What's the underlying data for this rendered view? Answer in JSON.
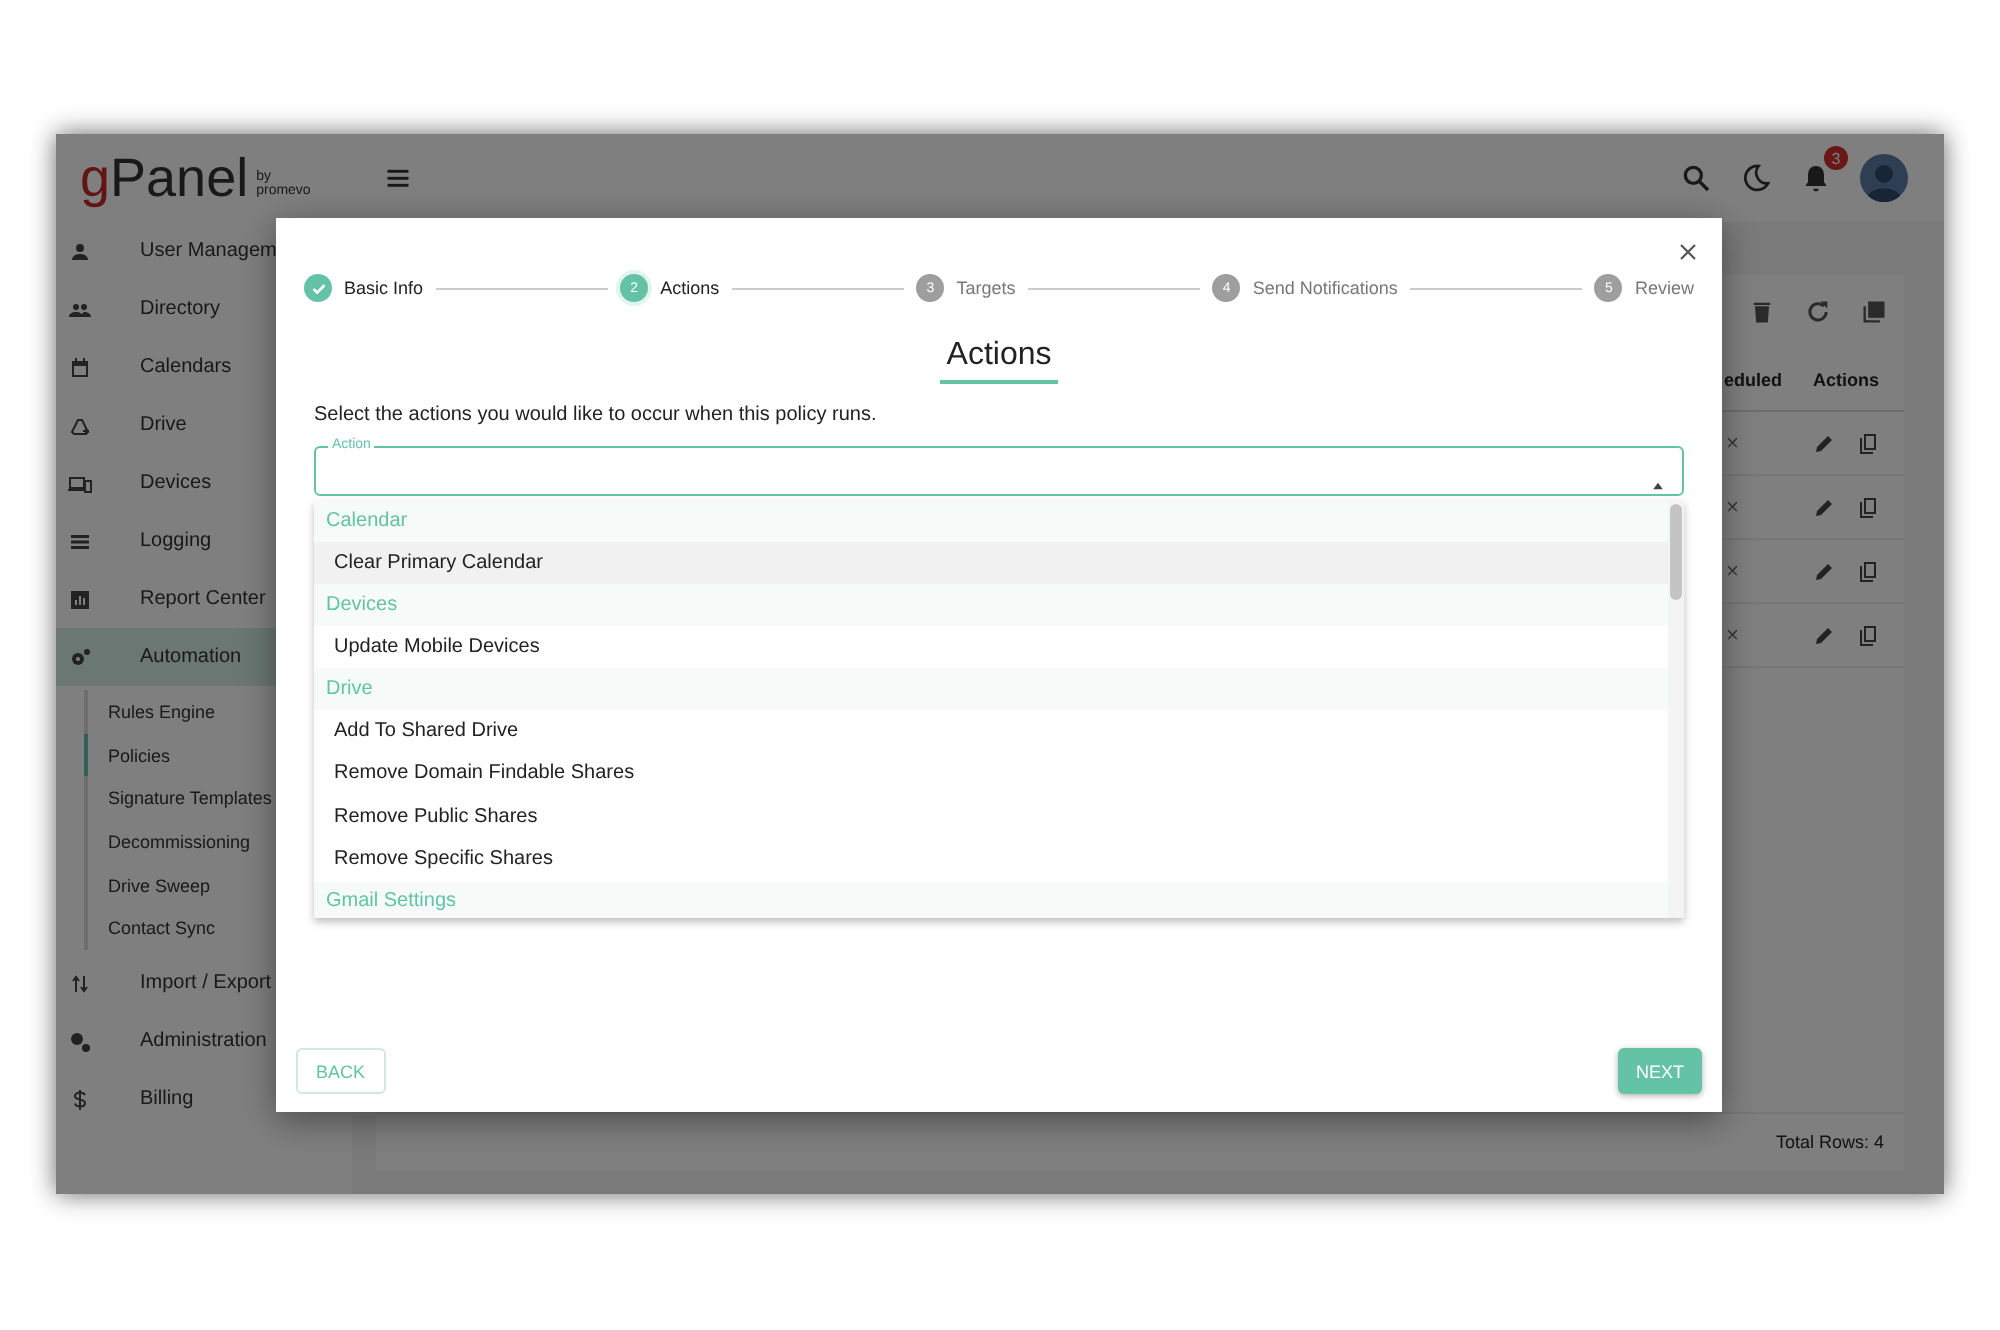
{
  "header": {
    "logo": {
      "letter": "g",
      "text": "Panel",
      "byline_1": "by",
      "byline_2": "promevo"
    },
    "notifications": "3"
  },
  "sidebar": {
    "items": [
      {
        "label": "User Managem",
        "selected": false
      },
      {
        "label": "Directory",
        "selected": false
      },
      {
        "label": "Calendars",
        "selected": false
      },
      {
        "label": "Drive",
        "selected": false
      },
      {
        "label": "Devices",
        "selected": false
      },
      {
        "label": "Logging",
        "selected": false
      },
      {
        "label": "Report Center",
        "selected": false
      },
      {
        "label": "Automation",
        "selected": true,
        "children": [
          {
            "label": "Rules Engine",
            "selected": false
          },
          {
            "label": "Policies",
            "selected": true
          },
          {
            "label": "Signature Templates",
            "selected": false
          },
          {
            "label": "Decommissioning",
            "selected": false
          },
          {
            "label": "Drive Sweep",
            "selected": false
          },
          {
            "label": "Contact Sync",
            "selected": false
          }
        ]
      },
      {
        "label": "Import / Export",
        "selected": false
      },
      {
        "label": "Administration",
        "selected": false
      },
      {
        "label": "Billing",
        "selected": false
      }
    ]
  },
  "table": {
    "columns": [
      "eduled",
      "Actions"
    ],
    "rows": [
      {
        "scheduled": "×"
      },
      {
        "scheduled": "×"
      },
      {
        "scheduled": "×"
      },
      {
        "scheduled": "×"
      }
    ],
    "footer": "Total Rows: 4"
  },
  "dialog": {
    "stepper": {
      "steps": [
        {
          "label": "Basic Info",
          "completed": true,
          "selected": false
        },
        {
          "number": "2",
          "label": "Actions",
          "completed": false,
          "selected": true
        },
        {
          "number": "3",
          "label": "Targets",
          "completed": false,
          "selected": false
        },
        {
          "number": "4",
          "label": "Send Notifications",
          "completed": false,
          "selected": false
        },
        {
          "number": "5",
          "label": "Review",
          "completed": false,
          "selected": false
        }
      ]
    },
    "title": "Actions",
    "description": "Select the actions you would like to occur when this policy runs.",
    "field": {
      "label": "Action",
      "expanded": true
    },
    "options": [
      {
        "heading": "Calendar",
        "items": [
          {
            "label": "Clear Primary Calendar",
            "highlighted": true
          }
        ]
      },
      {
        "heading": "Devices",
        "items": [
          {
            "label": "Update Mobile Devices",
            "highlighted": false
          }
        ]
      },
      {
        "heading": "Drive",
        "items": [
          {
            "label": "Add To Shared Drive",
            "highlighted": false
          },
          {
            "label": "Remove Domain Findable Shares",
            "highlighted": false
          },
          {
            "label": "Remove Public Shares",
            "highlighted": false
          },
          {
            "label": "Remove Specific Shares",
            "highlighted": false
          }
        ]
      },
      {
        "heading": "Gmail Settings"
      }
    ],
    "buttons": {
      "back": "BACK",
      "next": "NEXT"
    }
  }
}
